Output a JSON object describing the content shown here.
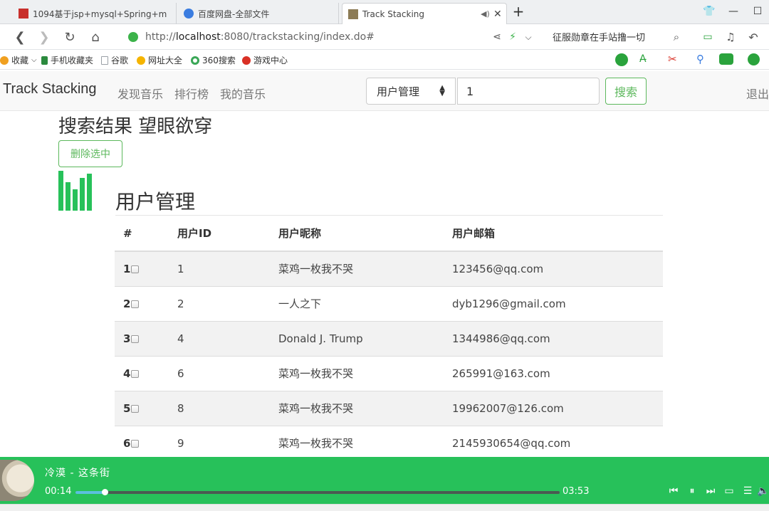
{
  "browser": {
    "tabs": [
      {
        "label": "1094基于jsp+mysql+Spring+m"
      },
      {
        "label": "百度网盘-全部文件"
      },
      {
        "label": "Track Stacking"
      }
    ],
    "url_scheme": "http://",
    "url_host": "localhost",
    "url_rest": ":8080/trackstacking/index.do#",
    "promo_text": "征服勋章在手站撸一切"
  },
  "bookmarks": [
    {
      "label": "收藏",
      "color": "#f0a020"
    },
    {
      "label": "手机收藏夹",
      "color": "#2b8a3e"
    },
    {
      "label": "谷歌",
      "color": "#9aa0a6"
    },
    {
      "label": "网址大全",
      "color": "#f5b400"
    },
    {
      "label": "360搜索",
      "color": "#3aa757"
    },
    {
      "label": "游戏中心",
      "color": "#d93025"
    }
  ],
  "navbar": {
    "brand": "Track Stacking",
    "links": [
      "发现音乐",
      "排行榜",
      "我的音乐"
    ],
    "search_type": "用户管理",
    "search_value": "1",
    "search_button": "搜索",
    "logout": "退出"
  },
  "content": {
    "result_heading": "搜索结果 望眼欲穿",
    "delete_button": "删除选中",
    "section_title": "用户管理",
    "table": {
      "headers": [
        "#",
        "用户ID",
        "用户昵称",
        "用户邮箱"
      ],
      "rows": [
        {
          "num": "1",
          "id": "1",
          "nickname": "菜鸡一枚我不哭",
          "email": "123456@qq.com"
        },
        {
          "num": "2",
          "id": "2",
          "nickname": "一人之下",
          "email": "dyb1296@gmail.com"
        },
        {
          "num": "3",
          "id": "4",
          "nickname": "Donald J. Trump",
          "email": "1344986@qq.com"
        },
        {
          "num": "4",
          "id": "6",
          "nickname": "菜鸡一枚我不哭",
          "email": "265991@163.com"
        },
        {
          "num": "5",
          "id": "8",
          "nickname": "菜鸡一枚我不哭",
          "email": "19962007@126.com"
        },
        {
          "num": "6",
          "id": "9",
          "nickname": "菜鸡一枚我不哭",
          "email": "2145930654@qq.com"
        }
      ]
    }
  },
  "player": {
    "song": "冷漠 - 这条街",
    "current_time": "00:14",
    "total_time": "03:53",
    "progress": 0.06,
    "accent_color": "#27c15a"
  }
}
